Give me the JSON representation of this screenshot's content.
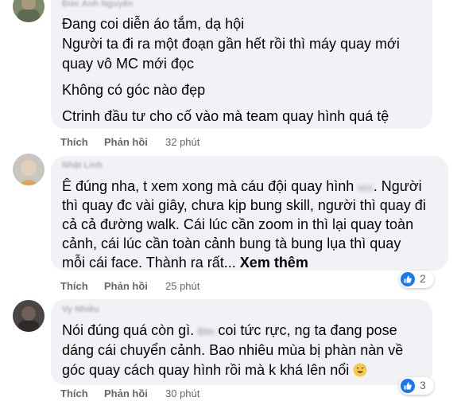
{
  "comments": [
    {
      "author": "Đức Anh Nguyễn",
      "lines": [
        "Đang coi diễn áo tắm, dạ hội",
        "Người ta đi ra một đoạn gần hết rồi thì máy quay mới",
        "quay vô MC mới đọc",
        "Không có góc nào đẹp",
        "Ctrinh đầu tư cho cố vào mà team quay hình quá tệ"
      ],
      "like_label": "Thích",
      "reply_label": "Phản hồi",
      "time": "32 phút"
    },
    {
      "author": "Nhật Linh",
      "lines": [
        "Ê đúng nha, t xem xong mà cáu đội quay hình",
        "vcc",
        ". Người",
        "thì quay đc vài giây, chưa kịp bung skill, người thì quay đi",
        "cả cả đường walk. Cái lúc cần zoom in thì lại quay toàn",
        "cảnh, cái lúc cần toàn cảnh bung tà bung lụa thì quay",
        "mỗi cái face. Thành ra rất...",
        "Xem thêm"
      ],
      "like_label": "Thích",
      "reply_label": "Phản hồi",
      "time": "25 phút",
      "reaction_count": "2",
      "reaction_icon": "like-icon",
      "reaction_color": "#1877f2"
    },
    {
      "author": "Vy Nhiều",
      "lines": [
        "Nói đúng quá còn gì.",
        "Đm",
        "coi tức rực, ng ta đang pose",
        "dáng cái chuyển cảnh. Bao nhiêu mùa bị phàn nàn về",
        "góc quay cách quay hình rồi mà k khá lên nổi"
      ],
      "emoji_icon": "grinning-sweat-face-icon",
      "like_label": "Thích",
      "reply_label": "Phản hồi",
      "time": "30 phút",
      "reaction_count": "3",
      "reaction_icon": "like-icon",
      "reaction_color": "#1877f2"
    }
  ]
}
